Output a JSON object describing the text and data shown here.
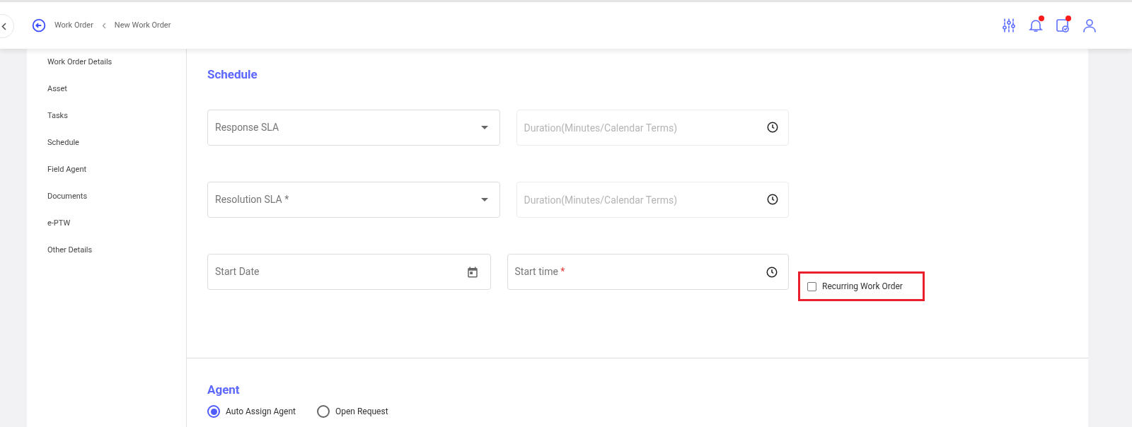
{
  "breadcrumb": [
    {
      "label": "Work Order"
    },
    {
      "label": "New Work Order"
    }
  ],
  "header_icons": [
    {
      "kind": "sliders",
      "badge": false
    },
    {
      "kind": "bell",
      "badge": true
    },
    {
      "kind": "calendar-check",
      "badge": true
    },
    {
      "kind": "user",
      "badge": false
    }
  ],
  "sidebar": {
    "items": [
      {
        "label": "Work Order Details"
      },
      {
        "label": "Asset"
      },
      {
        "label": "Tasks"
      },
      {
        "label": "Schedule"
      },
      {
        "label": "Field Agent"
      },
      {
        "label": "Documents"
      },
      {
        "label": "e-PTW"
      },
      {
        "label": "Other Details"
      }
    ]
  },
  "schedule": {
    "title": "Schedule",
    "rows": [
      [
        {
          "kind": "select",
          "label": "Response SLA"
        },
        {
          "kind": "duration",
          "placeholder": "Duration(Minutes/Calendar Terms)"
        }
      ],
      [
        {
          "kind": "select",
          "label": "Resolution SLA *"
        },
        {
          "kind": "duration",
          "placeholder": "Duration(Minutes/Calendar Terms)"
        }
      ],
      [
        {
          "kind": "date",
          "label": "Start Date"
        },
        {
          "kind": "time",
          "label": "Start time",
          "required_mark": "*"
        }
      ]
    ],
    "recurring": {
      "label": "Recurring Work Order",
      "checked": false,
      "highlighted": true
    }
  },
  "agent": {
    "title": "Agent",
    "options": [
      {
        "label": "Auto Assign Agent",
        "selected": true
      },
      {
        "label": "Open Request",
        "selected": false
      }
    ]
  }
}
